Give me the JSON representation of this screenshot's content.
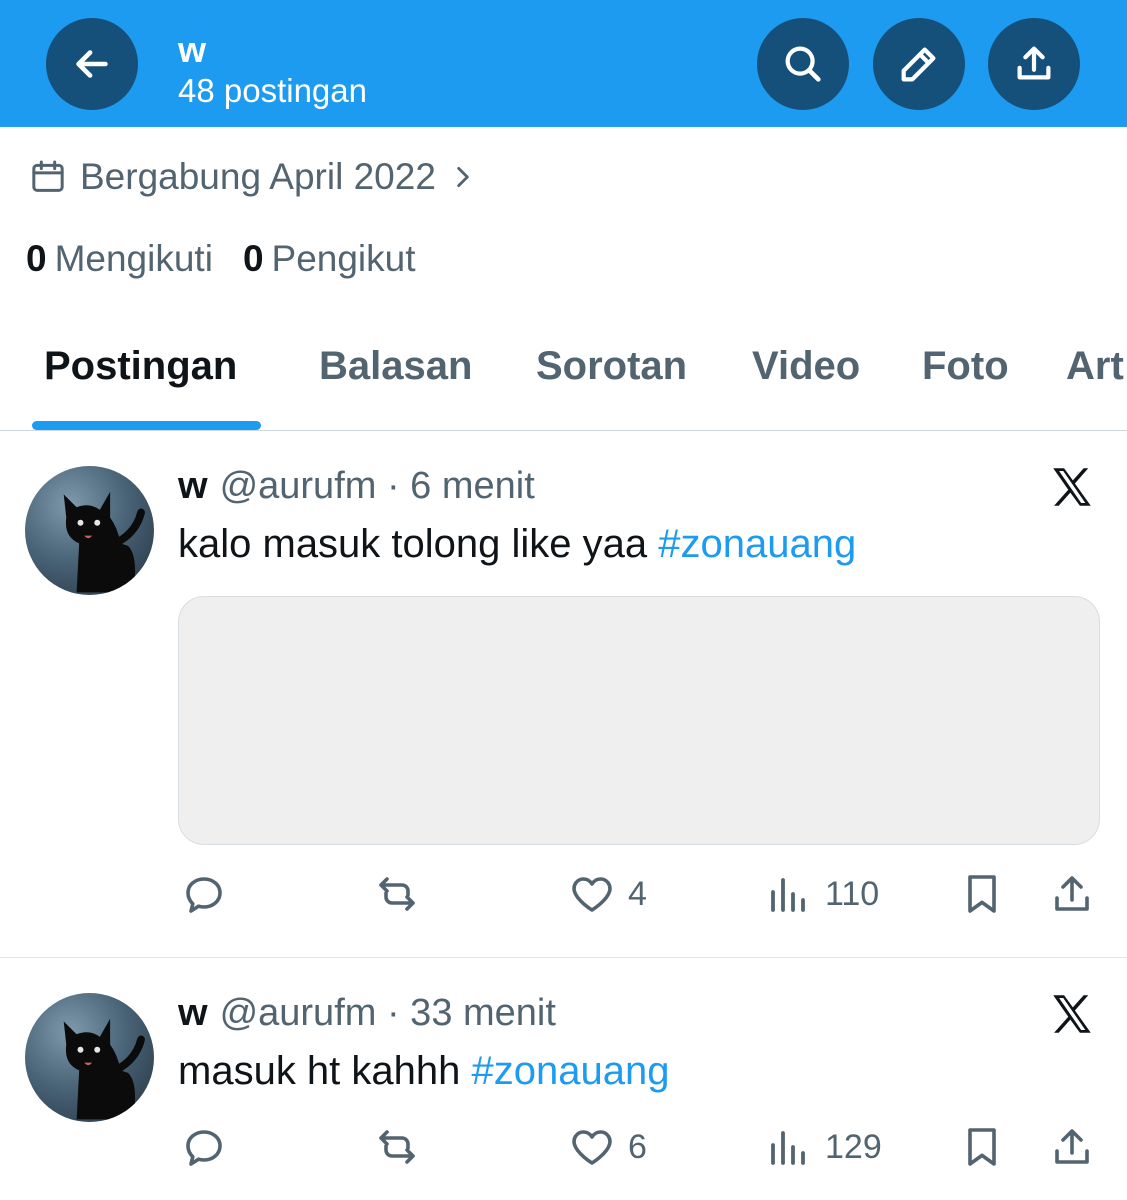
{
  "header": {
    "title": "w",
    "subtitle": "48 postingan",
    "background": "#1d9bf0",
    "button_color": "#15507a",
    "icons": [
      "arrow-left-icon",
      "search-icon",
      "pencil-icon",
      "share-icon"
    ]
  },
  "profile": {
    "joined": "Bergabung April 2022",
    "following_count": "0",
    "following_label": "Mengikuti",
    "followers_count": "0",
    "followers_label": "Pengikut"
  },
  "tabs": [
    {
      "label": "Postingan",
      "active": true
    },
    {
      "label": "Balasan",
      "active": false
    },
    {
      "label": "Sorotan",
      "active": false
    },
    {
      "label": "Video",
      "active": false
    },
    {
      "label": "Foto",
      "active": false
    },
    {
      "label": "Art",
      "active": false
    }
  ],
  "posts": [
    {
      "name": "w",
      "handle": "@aurufm",
      "time": "· 6 menit",
      "text": "kalo masuk tolong like yaa",
      "hashtag": "#zonauang",
      "has_media": true,
      "likes": "4",
      "views": "110"
    },
    {
      "name": "w",
      "handle": "@aurufm",
      "time": "· 33 menit",
      "text": "masuk ht kahhh",
      "hashtag": "#zonauang",
      "has_media": false,
      "likes": "6",
      "views": "129"
    }
  ],
  "colors": {
    "accent": "#1d9bf0",
    "text_primary": "#0f1419",
    "text_secondary": "#536471"
  }
}
